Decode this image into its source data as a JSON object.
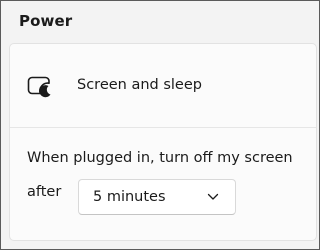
{
  "section": {
    "title": "Power"
  },
  "screen_sleep": {
    "label": "Screen and sleep",
    "icon": "screen-sleep-icon"
  },
  "plugged_in": {
    "text": "When plugged in, turn off my screen",
    "after_label": "after",
    "dropdown": {
      "value": "5 minutes",
      "icon": "chevron-down-icon"
    }
  }
}
